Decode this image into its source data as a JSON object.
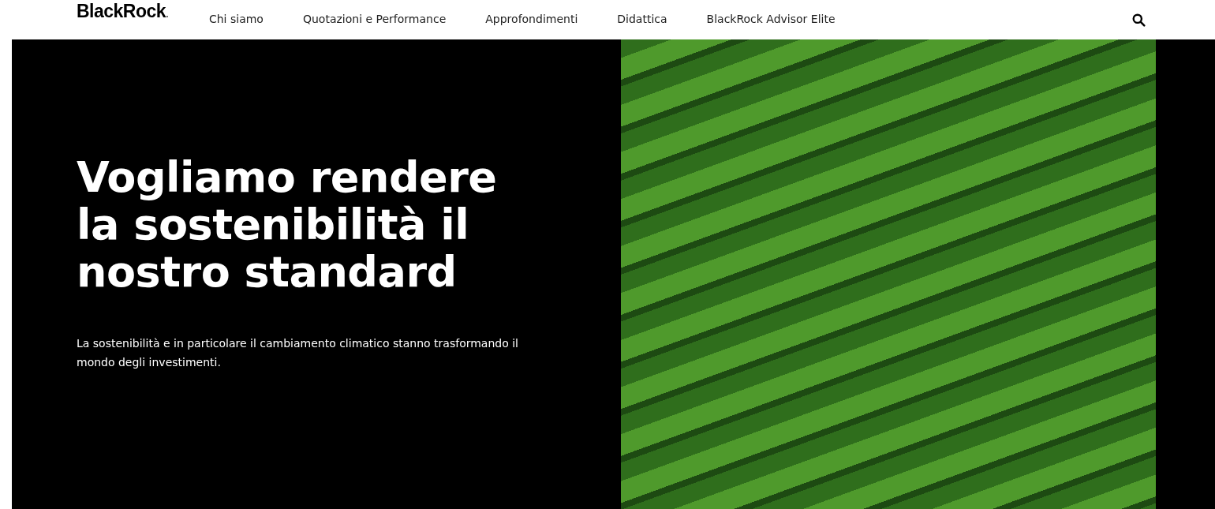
{
  "header": {
    "logo": "BlackRock",
    "logo_mark": ".",
    "nav": [
      {
        "label": "Chi siamo"
      },
      {
        "label": "Quotazioni e Performance"
      },
      {
        "label": "Approfondimenti"
      },
      {
        "label": "Didattica"
      },
      {
        "label": "BlackRock Advisor Elite"
      }
    ]
  },
  "hero": {
    "title": "Vogliamo rendere la sostenibilità il nostro standard",
    "text": "La sostenibilità e in particolare il cambiamento climatico stanno trasformando il mondo degli investimenti."
  }
}
